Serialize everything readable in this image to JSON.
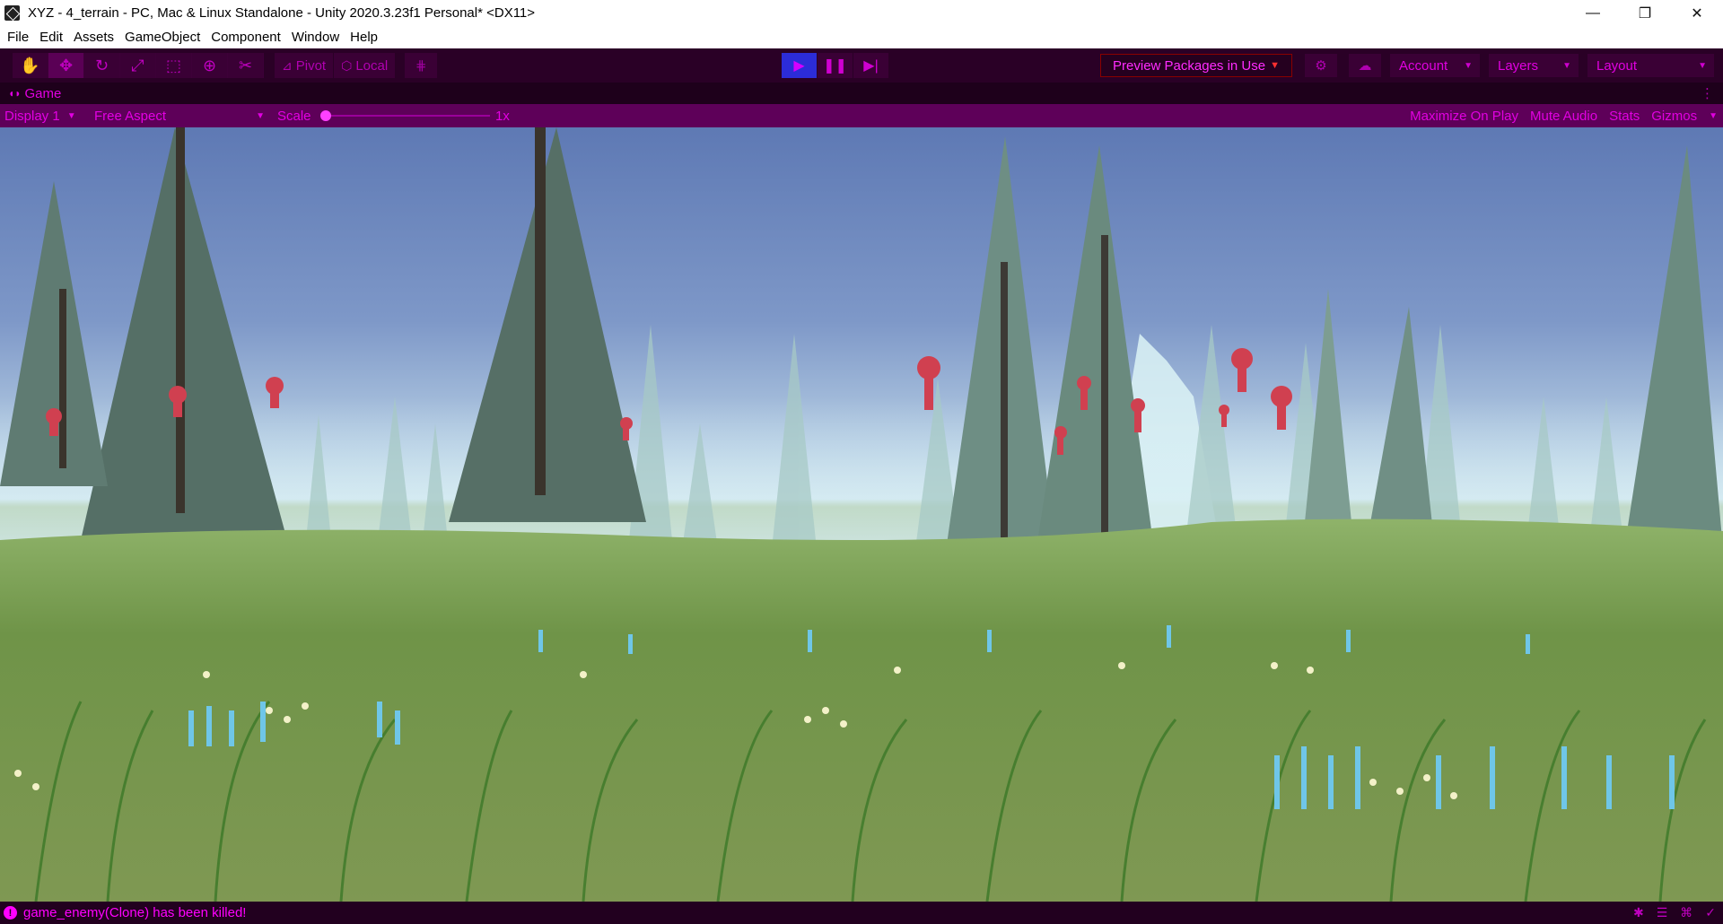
{
  "window": {
    "title": "XYZ - 4_terrain - PC, Mac & Linux Standalone - Unity 2020.3.23f1 Personal* <DX11>",
    "controls": [
      "—",
      "❐",
      "✕"
    ]
  },
  "menu": [
    "File",
    "Edit",
    "Assets",
    "GameObject",
    "Component",
    "Window",
    "Help"
  ],
  "toolbar": {
    "pivot_label": "Pivot",
    "local_label": "Local",
    "preview_packages_label": "Preview Packages in Use",
    "account_label": "Account",
    "layers_label": "Layers",
    "layout_label": "Layout"
  },
  "game_view": {
    "tab_label": "Game",
    "display_label": "Display 1",
    "aspect_label": "Free Aspect",
    "scale_label": "Scale",
    "scale_value": "1x",
    "maximize_label": "Maximize On Play",
    "mute_label": "Mute Audio",
    "stats_label": "Stats",
    "gizmos_label": "Gizmos"
  },
  "status": {
    "message": "game_enemy(Clone) has been killed!"
  },
  "colors": {
    "accent": "#e000e0",
    "toolbar_bg": "#2a0026",
    "gamebar_bg": "#5e0059",
    "play_active": "#2c2cd8",
    "enemy": "#d04050"
  }
}
